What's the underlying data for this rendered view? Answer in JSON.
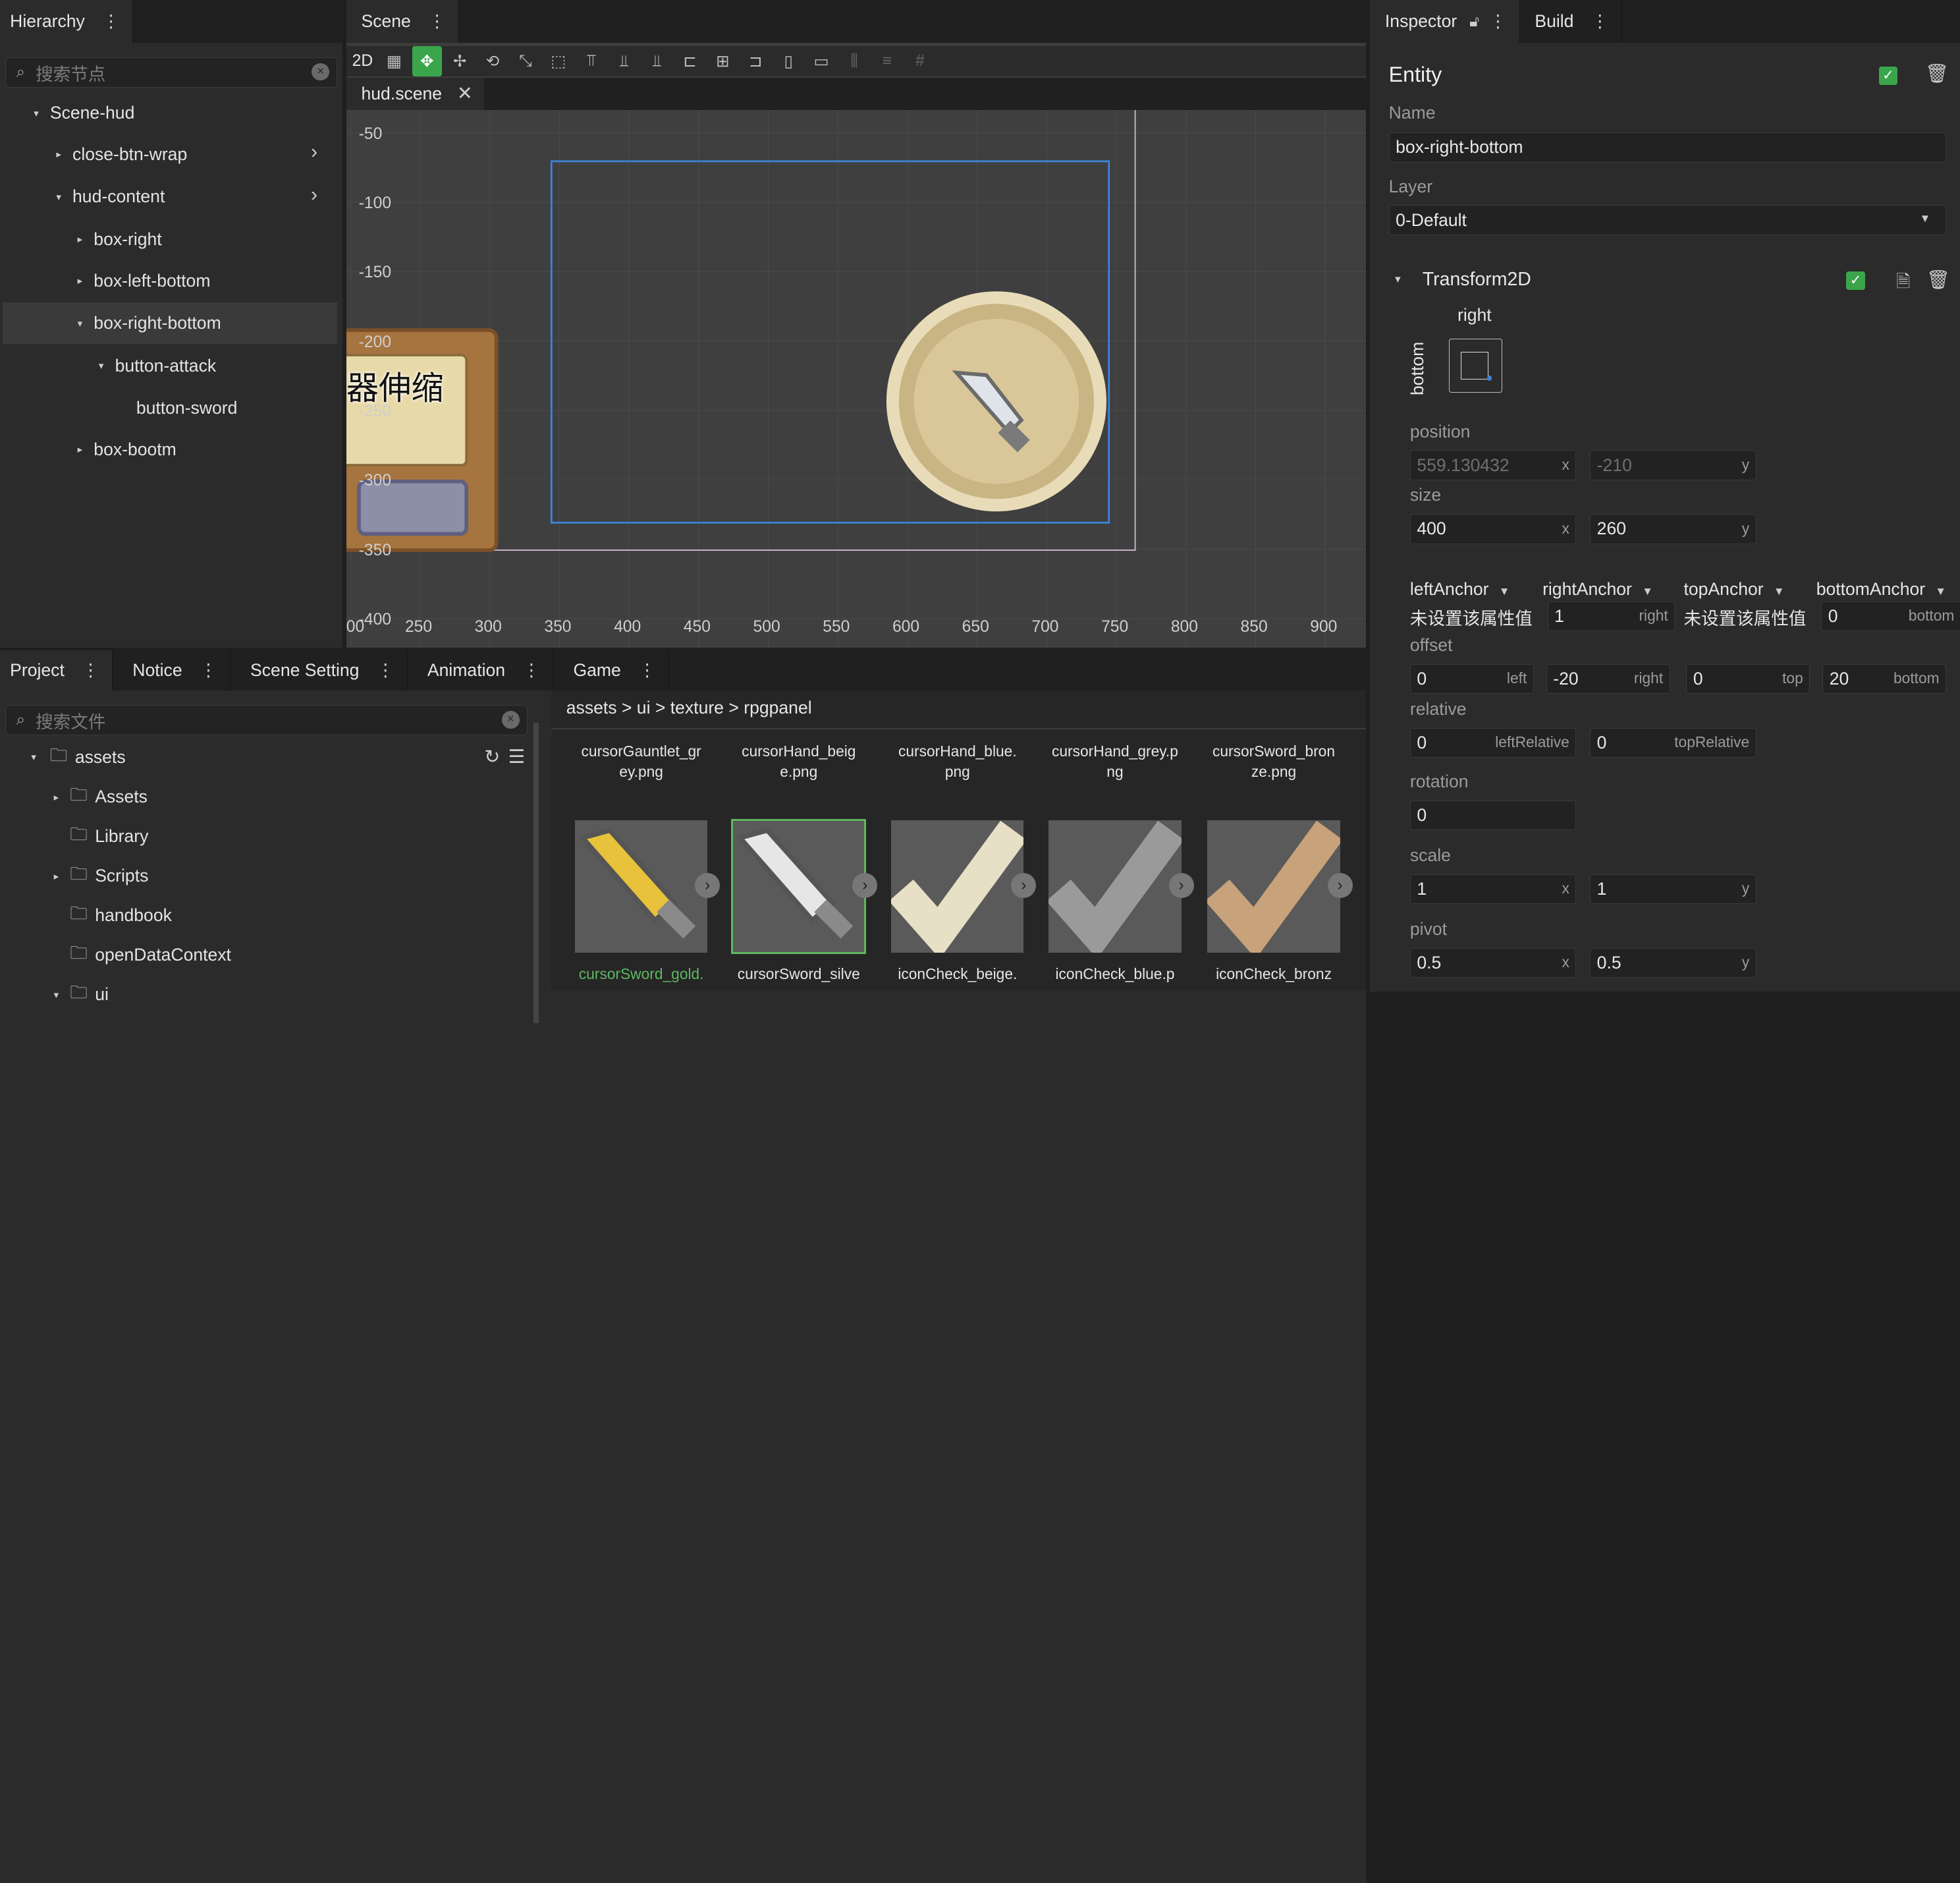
{
  "hierarchy": {
    "tab": "Hierarchy",
    "search_placeholder": "搜索节点",
    "nodes": [
      {
        "label": "Scene-hud",
        "caret": "▾",
        "chev": ""
      },
      {
        "label": "close-btn-wrap",
        "caret": "▸",
        "chev": "›"
      },
      {
        "label": "hud-content",
        "caret": "▾",
        "chev": "›"
      },
      {
        "label": "box-right",
        "caret": "▸",
        "chev": ""
      },
      {
        "label": "box-left-bottom",
        "caret": "▸",
        "chev": ""
      },
      {
        "label": "box-right-bottom",
        "caret": "▾",
        "chev": ""
      },
      {
        "label": "button-attack",
        "caret": "▾",
        "chev": ""
      },
      {
        "label": "button-sword",
        "caret": "",
        "chev": ""
      },
      {
        "label": "box-bootm",
        "caret": "▸",
        "chev": ""
      }
    ]
  },
  "scene": {
    "tab": "Scene",
    "file_tab": "hud.scene",
    "toolbar_2d": "2D",
    "overlay_text": "器伸缩",
    "y_ticks": [
      "-50",
      "-100",
      "-150",
      "-200",
      "-250",
      "-300",
      "-350",
      "-400"
    ],
    "x_ticks": [
      "00",
      "250",
      "300",
      "350",
      "400",
      "450",
      "500",
      "550",
      "600",
      "650",
      "700",
      "750",
      "800",
      "850",
      "900"
    ]
  },
  "bottom_tabs": [
    "Project",
    "Notice",
    "Scene Setting",
    "Animation",
    "Game"
  ],
  "project": {
    "search_placeholder": "搜索文件",
    "root": "assets",
    "folders": [
      "Assets",
      "Library",
      "Scripts",
      "handbook",
      "openDataContext",
      "ui"
    ],
    "breadcrumb": "assets > ui > texture > rpgpanel",
    "top_files": [
      [
        "cursorGauntlet_gr",
        "ey.png"
      ],
      [
        "cursorHand_beig",
        "e.png"
      ],
      [
        "cursorHand_blue.",
        "png"
      ],
      [
        "cursorHand_grey.p",
        "ng"
      ],
      [
        "cursorSword_bron",
        "ze.png"
      ]
    ],
    "thumb_names": [
      "cursorSword_gold.",
      "cursorSword_silve",
      "iconCheck_beige.",
      "iconCheck_blue.p",
      "iconCheck_bronz"
    ],
    "colors": {
      "selected_name": "#5fb760",
      "gold": "#e8c23a",
      "silver": "#e6e6e6",
      "beige": "#e7dfc6",
      "blue": "#9a9a9a",
      "bronze": "#c8a27a"
    }
  },
  "inspector": {
    "tab": "Inspector",
    "build_tab": "Build",
    "entity_title": "Entity",
    "name_label": "Name",
    "name_value": "box-right-bottom",
    "layer_label": "Layer",
    "layer_value": "0-Default",
    "transform_title": "Transform2D",
    "anchor_h": "right",
    "anchor_v": "bottom",
    "position_label": "position",
    "position_x": "559.130432",
    "position_y": "-210",
    "size_label": "size",
    "size_x": "400",
    "size_y": "260",
    "anchors": [
      {
        "label": "leftAnchor",
        "value": "未设置该属性值",
        "suffix": ""
      },
      {
        "label": "rightAnchor",
        "value": "1",
        "suffix": "right"
      },
      {
        "label": "topAnchor",
        "value": "未设置该属性值",
        "suffix": ""
      },
      {
        "label": "bottomAnchor",
        "value": "0",
        "suffix": "bottom"
      }
    ],
    "offset_label": "offset",
    "offsets": [
      {
        "value": "0",
        "suffix": "left"
      },
      {
        "value": "-20",
        "suffix": "right"
      },
      {
        "value": "0",
        "suffix": "top"
      },
      {
        "value": "20",
        "suffix": "bottom"
      }
    ],
    "relative_label": "relative",
    "relatives": [
      {
        "value": "0",
        "suffix": "leftRelative"
      },
      {
        "value": "0",
        "suffix": "topRelative"
      }
    ],
    "rotation_label": "rotation",
    "rotation_value": "0",
    "scale_label": "scale",
    "scale_x": "1",
    "scale_y": "1",
    "pivot_label": "pivot",
    "pivot_x": "0.5",
    "pivot_y": "0.5",
    "x_suffix": "x",
    "y_suffix": "y"
  }
}
